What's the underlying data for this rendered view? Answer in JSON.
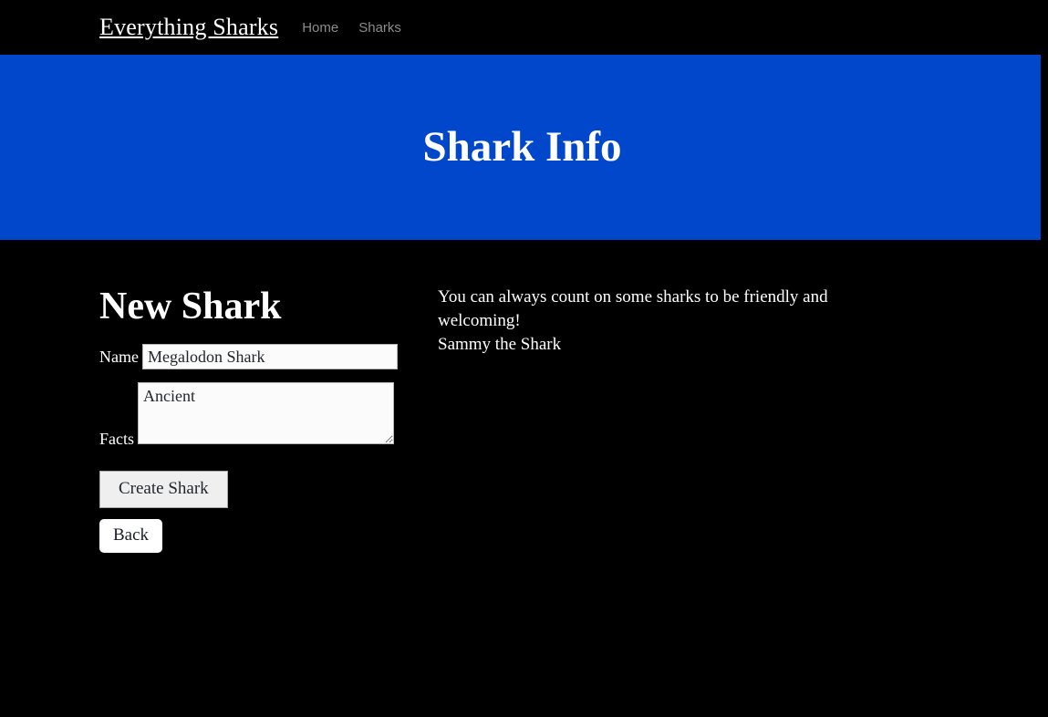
{
  "navbar": {
    "brand": "Everything Sharks",
    "links": [
      {
        "label": "Home"
      },
      {
        "label": "Sharks"
      }
    ]
  },
  "jumbotron": {
    "title": "Shark Info",
    "background_color": "#0047CC"
  },
  "form": {
    "heading": "New Shark",
    "name": {
      "label": "Name",
      "value": "Megalodon Shark",
      "placeholder": ""
    },
    "facts": {
      "label": "Facts",
      "value": "Ancient",
      "placeholder": ""
    },
    "submit_label": "Create Shark",
    "back_label": "Back"
  },
  "quote": {
    "text": "You can always count on some sharks to be friendly and welcoming!",
    "author": "Sammy the Shark"
  },
  "theme": {
    "page_background": "#000000",
    "accent_blue": "#0047CC",
    "text_color": "#FFFFFF",
    "nav_link_color": "#8B8B8B"
  }
}
